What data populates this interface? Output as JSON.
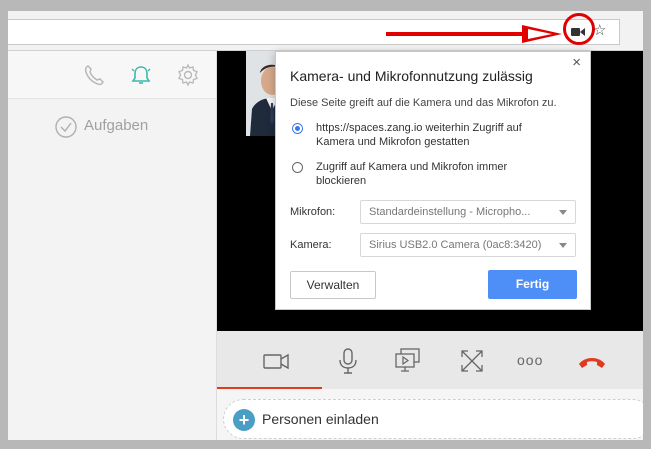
{
  "browser": {
    "camera_indicator_icon": "video-camera-icon",
    "star_icon": "☆",
    "menu_icon": "⋮"
  },
  "sidebar": {
    "icons": [
      "phone-icon",
      "bell-icon",
      "gear-icon"
    ],
    "tasks_label": "Aufgaben"
  },
  "popup": {
    "close": "×",
    "title": "Kamera- und Mikrofonnutzung zulässig",
    "description": "Diese Seite greift auf die Kamera und das Mikrofon zu.",
    "option_allow": "https://spaces.zang.io weiterhin Zugriff auf Kamera und Mikrofon gestatten",
    "option_block": "Zugriff auf Kamera und Mikrofon immer blockieren",
    "selected_option": "allow",
    "microphone_label": "Mikrofon:",
    "microphone_value": "Standardeinstellung - Micropho...",
    "camera_label": "Kamera:",
    "camera_value": "Sirius USB2.0 Camera (0ac8:3420)",
    "manage_button": "Verwalten",
    "done_button": "Fertig"
  },
  "call_controls": {
    "icons": [
      "video-camera-icon",
      "microphone-icon",
      "screen-share-icon",
      "fullscreen-icon",
      "more-icon",
      "hang-up-icon"
    ],
    "more_label": "ooo",
    "accent_color": "#e03a1f"
  },
  "invite": {
    "plus": "+",
    "label": "Personen einladen"
  }
}
